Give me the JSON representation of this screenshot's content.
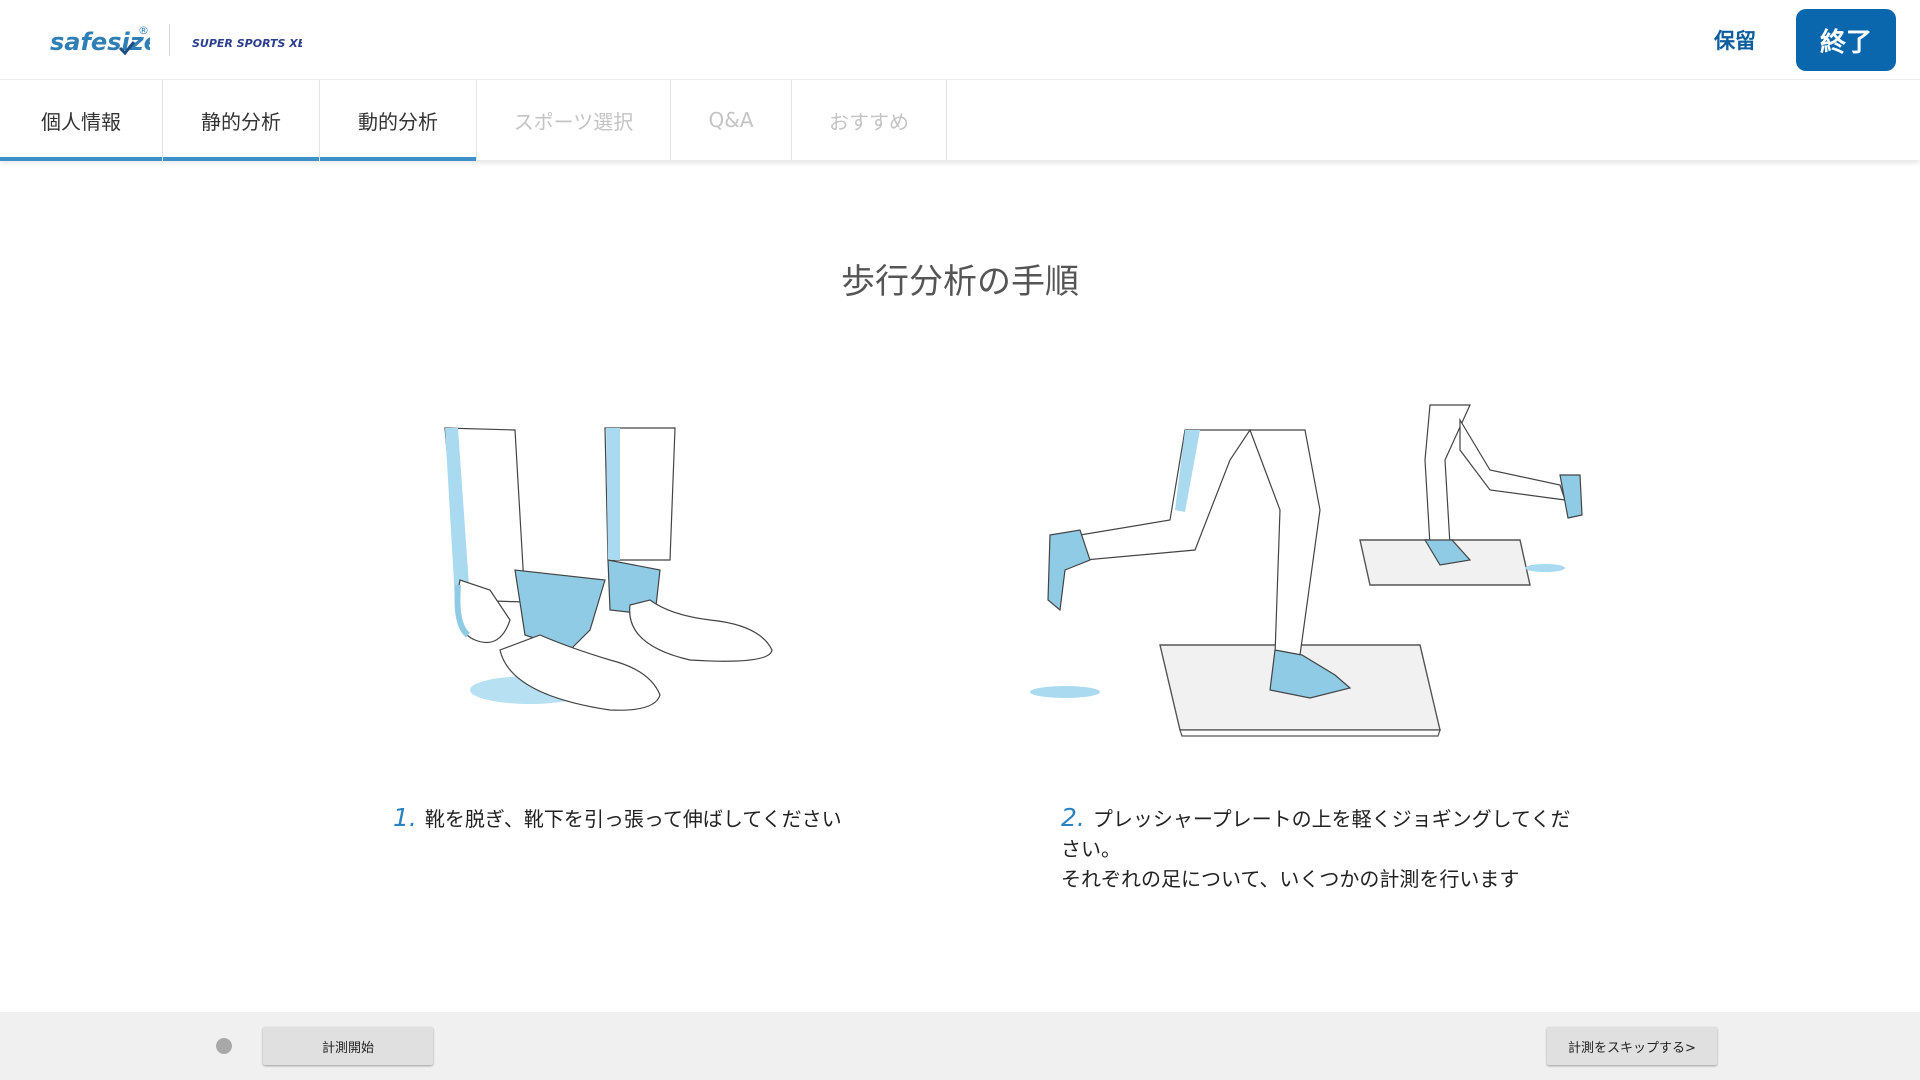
{
  "header": {
    "logo_safesize": "safesize",
    "logo_registered": "®",
    "logo_partner": "SUPER SPORTS XEBIO",
    "hold_label": "保留",
    "end_label": "終了"
  },
  "tabs": [
    {
      "label": "個人情報",
      "state": "done"
    },
    {
      "label": "静的分析",
      "state": "enabled"
    },
    {
      "label": "動的分析",
      "state": "active"
    },
    {
      "label": "スポーツ選択",
      "state": "disabled"
    },
    {
      "label": "Q&A",
      "state": "disabled"
    },
    {
      "label": "おすすめ",
      "state": "disabled"
    }
  ],
  "main": {
    "title": "歩行分析の手順",
    "steps": [
      {
        "number": "1.",
        "text": "靴を脱ぎ、靴下を引っ張って伸ばしてください"
      },
      {
        "number": "2.",
        "text": "プレッシャープレートの上を軽くジョギングしてください。",
        "text2": "それぞれの足について、いくつかの計測を行います"
      }
    ]
  },
  "footer": {
    "start_label": "計測開始",
    "skip_label": "計測をスキップする>"
  },
  "colors": {
    "brand_blue": "#0a67ad",
    "tab_underline": "#3d91c9",
    "sock_blue": "#8fcbe5",
    "footer_bg": "#f0f0f0"
  },
  "icons": [
    "status-dot-icon"
  ]
}
